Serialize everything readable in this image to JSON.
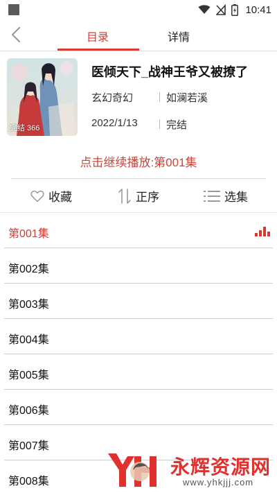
{
  "status_bar": {
    "time": "10:41",
    "icons": [
      "wifi-icon",
      "no-signal-icon",
      "battery-charging-icon"
    ]
  },
  "header": {
    "back_icon": "chevron-left-icon",
    "tabs": [
      {
        "label": "目录",
        "active": true
      },
      {
        "label": "详情",
        "active": false
      }
    ]
  },
  "book": {
    "title": "医倾天下_战神王爷又被撩了",
    "genre": "玄幻奇幻",
    "author": "如澜若溪",
    "date": "2022/1/13",
    "status": "完结",
    "cover_badge": "完结 366"
  },
  "continue_play": "点击继续播放:第001集",
  "actions": {
    "favorite": {
      "label": "收藏",
      "icon": "heart-outline-icon"
    },
    "order": {
      "label": "正序",
      "icon": "sort-icon"
    },
    "select": {
      "label": "选集",
      "icon": "list-icon"
    }
  },
  "episodes": [
    {
      "label": "第001集",
      "active": true
    },
    {
      "label": "第002集",
      "active": false
    },
    {
      "label": "第003集",
      "active": false
    },
    {
      "label": "第004集",
      "active": false
    },
    {
      "label": "第005集",
      "active": false
    },
    {
      "label": "第006集",
      "active": false
    },
    {
      "label": "第007集",
      "active": false
    },
    {
      "label": "第008集",
      "active": false
    }
  ],
  "watermark": {
    "text": "永辉资源网",
    "url": "www.yhkjjj.com"
  },
  "colors": {
    "accent": "#d33b33",
    "continue": "#c8453c"
  }
}
